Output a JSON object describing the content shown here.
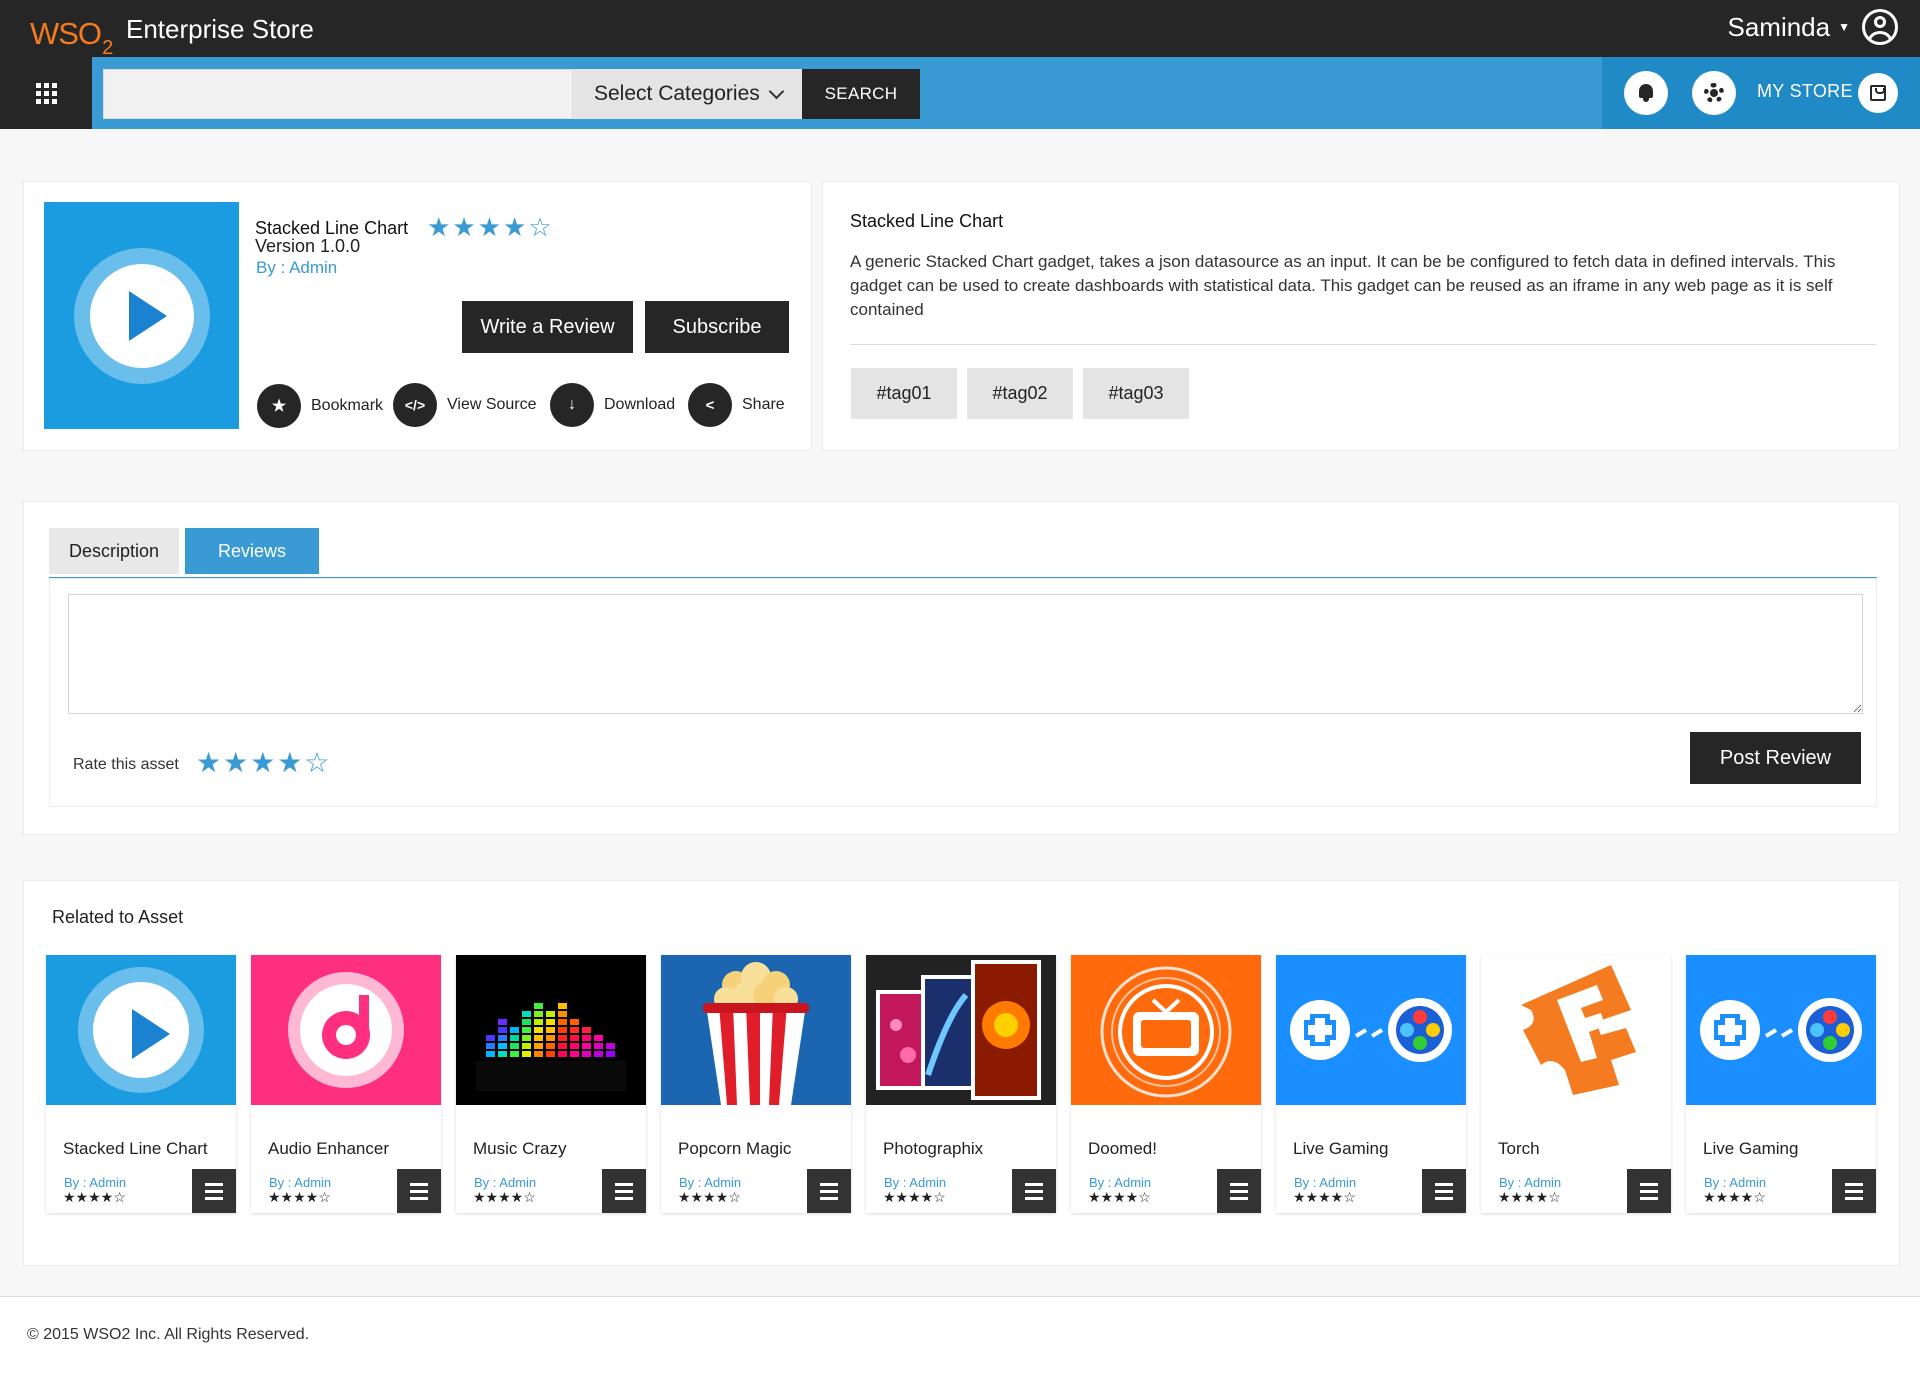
{
  "header": {
    "brand_logo": "WSO2",
    "brand_title": "Enterprise Store",
    "user_name": "Saminda"
  },
  "nav": {
    "search_placeholder": "",
    "category_select": "Select Categories",
    "search_button": "SEARCH",
    "my_store": "MY STORE"
  },
  "asset": {
    "title": "Stacked Line Chart",
    "rating_stars": "★★★★☆",
    "version": "Version 1.0.0",
    "by": "By : Admin",
    "write_review": "Write a Review",
    "subscribe": "Subscribe",
    "actions": [
      "Bookmark",
      "View Source",
      "Download",
      "Share"
    ],
    "desc_title": "Stacked Line Chart",
    "description": "A generic Stacked Chart gadget, takes a json datasource as an input. It can be be configured to fetch data in defined intervals. This gadget can be used to create dashboards with statistical data. This gadget can be reused as an iframe in any web page as it is self contained",
    "tags": [
      "#tag01",
      "#tag02",
      "#tag03"
    ]
  },
  "tabs": {
    "description": "Description",
    "reviews": "Reviews",
    "active": "Reviews"
  },
  "review": {
    "rate_label": "Rate this asset",
    "rate_stars": "★★★★☆",
    "post_button": "Post Review"
  },
  "related": {
    "heading": "Related to Asset",
    "items": [
      {
        "name": "Stacked Line Chart",
        "by": "By : Admin",
        "stars": "★★★★☆",
        "icon": "play-icon"
      },
      {
        "name": "Audio Enhancer",
        "by": "By : Admin",
        "stars": "★★★★☆",
        "icon": "music-note-icon"
      },
      {
        "name": "Music Crazy",
        "by": "By : Admin",
        "stars": "★★★★☆",
        "icon": "equalizer-icon"
      },
      {
        "name": "Popcorn Magic",
        "by": "By : Admin",
        "stars": "★★★★☆",
        "icon": "popcorn-icon"
      },
      {
        "name": "Photographix",
        "by": "By : Admin",
        "stars": "★★★★☆",
        "icon": "photos-icon"
      },
      {
        "name": "Doomed!",
        "by": "By : Admin",
        "stars": "★★★★☆",
        "icon": "tv-icon"
      },
      {
        "name": "Live Gaming",
        "by": "By : Admin",
        "stars": "★★★★☆",
        "icon": "gamepad-icon"
      },
      {
        "name": "Torch",
        "by": "By : Admin",
        "stars": "★★★★☆",
        "icon": "torch-f-icon"
      },
      {
        "name": "Live Gaming",
        "by": "By : Admin",
        "stars": "★★★★☆",
        "icon": "gamepad-icon"
      }
    ]
  },
  "footer": {
    "copyright": "© 2015 WSO2 Inc. All Rights Reserved."
  },
  "colors": {
    "accent": "#3a9ad4",
    "dark": "#262626",
    "brand_orange": "#f47b20"
  }
}
